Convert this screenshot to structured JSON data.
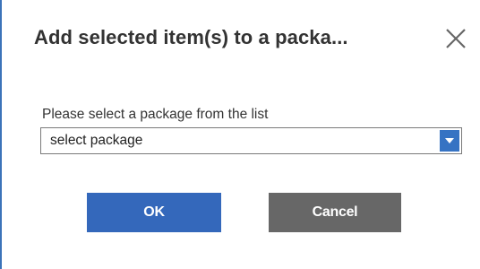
{
  "dialog": {
    "title": "Add selected item(s) to a packa...",
    "close_icon": "close-icon"
  },
  "form": {
    "label": "Please select a package from the list",
    "select_value": "select package",
    "dropdown_icon": "triangle-down-icon"
  },
  "buttons": {
    "ok_label": "OK",
    "cancel_label": "Cancel"
  },
  "colors": {
    "accent": "#3468bb",
    "dropdown_button": "#3673c3",
    "cancel_button": "#676767",
    "dialog_border": "#3b73b9"
  }
}
